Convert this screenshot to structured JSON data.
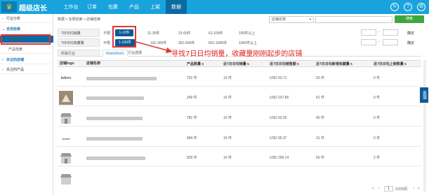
{
  "app": {
    "logo_text": "超级店长",
    "crown_glyph": "♛"
  },
  "nav": [
    "工作台",
    "订单",
    "包裹",
    "产品",
    "上架",
    "数据"
  ],
  "nav_active": 5,
  "topbar_icons": [
    "refresh-icon",
    "help-icon",
    "settings-icon"
  ],
  "sidebar": {
    "industry": "行业分析",
    "group1": "全局检索",
    "shop_search": "店铺检索",
    "product_search": "产品检索",
    "group2": "关注的店铺",
    "followed_products": "关注的产品"
  },
  "breadcrumb": "数据 » 全局检索 » 店铺检索",
  "search": {
    "select_label": "店铺名称",
    "input_value": "",
    "button": "搜索"
  },
  "filters": {
    "daily_sales": {
      "label": "7日日均销量",
      "options": [
        "不限",
        "1-10件",
        "11-30件",
        "31-60件",
        "61-100件",
        "100件以上"
      ],
      "selected": "1-10件",
      "confirm": "确定"
    },
    "daily_fav": {
      "label": "7日日均收藏量",
      "options": [
        "不限",
        "1-100件",
        "101-300件",
        "301-600件",
        "601-1000件",
        "1000件以上"
      ],
      "selected": "1-100件",
      "confirm": "确定"
    },
    "range_sep": "-"
  },
  "tabs": [
    "所属行业",
    "Wish(Wish)",
    "行业选择"
  ],
  "callout": "寻找7日日均销量，收藏量刚刚起步的店铺",
  "table": {
    "headers": [
      "店铺logo",
      "店铺名称",
      "产品数量",
      "近7日日均销量",
      "近7日日均销售额",
      "近7日日均新增收藏量",
      "近7日日均上架数量"
    ],
    "rows": [
      {
        "logo": "bellem",
        "products": "752 件",
        "sales": "10 件",
        "revenue": "USD 63.71",
        "fav": "53 件",
        "listed": "0 件"
      },
      {
        "logo": "photo",
        "products": "249 件",
        "sales": "10 件",
        "revenue": "USD 237.86",
        "fav": "61 件",
        "listed": "0 件"
      },
      {
        "logo": "store",
        "products": "782 件",
        "sales": "10 件",
        "revenue": "USD 63.29",
        "fav": "45 件",
        "listed": "0 件"
      },
      {
        "logo": "brand",
        "products": "684 件",
        "sales": "10 件",
        "revenue": "USD 95.37",
        "fav": "31 件",
        "listed": "0 件"
      },
      {
        "logo": "store",
        "products": "829 件",
        "sales": "10 件",
        "revenue": "USD 299.14",
        "fav": "55 件",
        "listed": "2 件"
      }
    ]
  },
  "pagination": {
    "current": "1",
    "total": "/1333页"
  },
  "side_tab": "客服"
}
